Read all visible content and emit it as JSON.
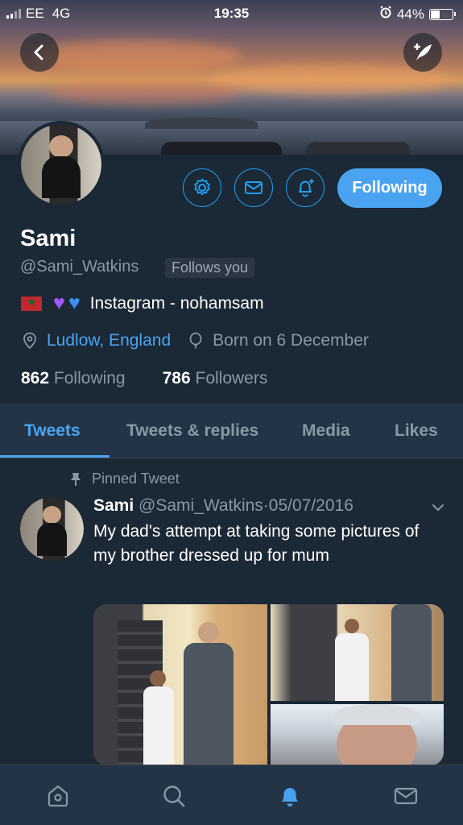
{
  "status_bar": {
    "carrier": "EE",
    "network": "4G",
    "time": "19:35",
    "battery": "44%",
    "battery_level": 0.44
  },
  "profile": {
    "name": "Sami",
    "handle": "@Sami_Watkins",
    "follows_you": "Follows you",
    "bio": "Instagram - nohamsam",
    "location": "Ludlow, England",
    "birthday": "Born on 6 December",
    "following_count": "862",
    "following_label": "Following",
    "followers_count": "786",
    "followers_label": "Followers",
    "follow_button": "Following"
  },
  "tabs": [
    {
      "label": "Tweets",
      "active": true
    },
    {
      "label": "Tweets & replies",
      "active": false
    },
    {
      "label": "Media",
      "active": false
    },
    {
      "label": "Likes",
      "active": false
    }
  ],
  "tweet": {
    "pinned_label": "Pinned Tweet",
    "author": "Sami",
    "handle": "@Sami_Watkins",
    "date": "05/07/2016",
    "text": "My dad's attempt at taking some pictures of my brother dressed up for mum"
  },
  "icons": {
    "back": "back-arrow-icon",
    "compose": "compose-tweet-icon",
    "settings": "gear-icon",
    "message": "envelope-icon",
    "notifications": "bell-plus-icon",
    "location": "location-pin-icon",
    "birthday": "balloon-icon",
    "pinned": "pin-icon",
    "chevron": "chevron-down-icon",
    "nav": [
      "home-icon",
      "search-icon",
      "bell-icon",
      "mail-icon"
    ]
  },
  "colors": {
    "background": "#1b2836",
    "tab_bar": "#243447",
    "accent": "#4aa3f0",
    "secondary_text": "#8899a6"
  }
}
